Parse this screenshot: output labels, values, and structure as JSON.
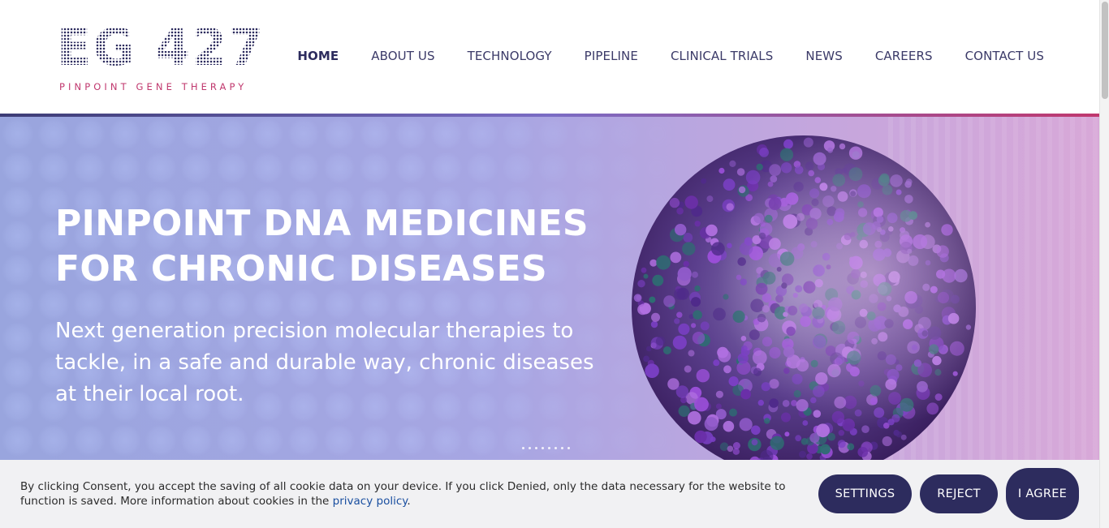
{
  "header": {
    "logo_text": "EG 427",
    "logo_tagline": "PINPOINT GENE THERAPY",
    "nav": [
      {
        "label": "HOME",
        "active": true
      },
      {
        "label": "ABOUT US"
      },
      {
        "label": "TECHNOLOGY"
      },
      {
        "label": "PIPELINE"
      },
      {
        "label": "CLINICAL TRIALS"
      },
      {
        "label": "NEWS"
      },
      {
        "label": "CAREERS"
      },
      {
        "label": "CONTACT US"
      }
    ]
  },
  "hero": {
    "title_line1": "PINPOINT DNA MEDICINES",
    "title_line2": "FOR CHRONIC DISEASES",
    "subtitle": "Next generation precision molecular therapies to tackle, in a safe and durable way, chronic diseases at their local root.",
    "image_icon": "virus-particle-image"
  },
  "cookie_bar": {
    "text_before_link": "By clicking Consent, you accept the saving of all cookie data on your device. If you click Denied, only the data necessary for the website to function is saved. More information about cookies in the ",
    "link_text": "privacy policy",
    "text_after_link": ".",
    "settings_label": "SETTINGS",
    "reject_label": "REJECT",
    "agree_label": "I AGREE"
  },
  "colors": {
    "brand_navy": "#2d2c5e",
    "brand_pink": "#c0386e",
    "link_blue": "#1a4fa0"
  }
}
